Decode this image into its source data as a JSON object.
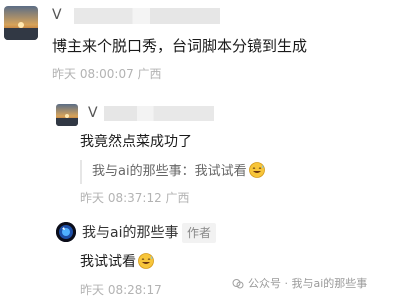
{
  "comment": {
    "user_visible_initial": "V",
    "text": "博主来个脱口秀，台词脚本分镜到生成",
    "meta": "昨天 08:00:07 广西"
  },
  "reply1": {
    "user_visible_initial": "V",
    "text": "我竟然点菜成功了",
    "quote_text": "我与ai的那些事：我试试看",
    "meta": "昨天 08:37:12 广西"
  },
  "reply2": {
    "user": "我与ai的那些事",
    "badge": "作者",
    "text": "我试试看",
    "meta": "昨天 08:28:17"
  },
  "watermark": {
    "text": "公众号 · 我与ai的那些事"
  },
  "icons": {
    "emoji": "grinning-sweat-emoji",
    "watermark_icon": "wechat-official-account-icon"
  }
}
